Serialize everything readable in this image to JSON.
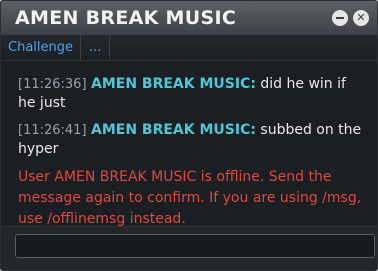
{
  "window": {
    "title": "AMEN BREAK MUSIC",
    "minimize_icon": "minimize-icon",
    "close_icon": "close-icon"
  },
  "tabs": [
    {
      "label": "Challenge"
    },
    {
      "label": "..."
    }
  ],
  "messages": [
    {
      "timestamp": "[11:26:36]",
      "sender": "AMEN BREAK MUSIC:",
      "text": "did he win if he just"
    },
    {
      "timestamp": "[11:26:41]",
      "sender": "AMEN BREAK MUSIC:",
      "text": "subbed on the hyper"
    }
  ],
  "system_message": "User AMEN BREAK MUSIC is offline. Send the message again to confirm. If you are using /msg, use /offlinemsg instead.",
  "input": {
    "value": "",
    "placeholder": ""
  },
  "colors": {
    "sender": "#4ec8d8",
    "system": "#e0483c",
    "tab_link": "#4aa3e8"
  }
}
